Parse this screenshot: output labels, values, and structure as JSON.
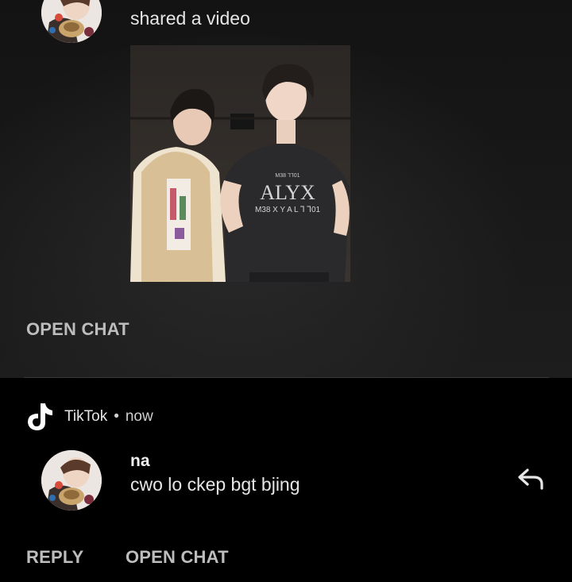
{
  "notification_1": {
    "shared_text": "shared a video",
    "thumbnail": {
      "shirt_line_1": "M38 ⅂⅂01",
      "shirt_brand": "ALYX",
      "shirt_line_2": "M38 X Y A L ⅂ ⅂01"
    },
    "open_chat_label": "OPEN CHAT"
  },
  "notification_2": {
    "app_name": "TikTok",
    "separator": "•",
    "time": "now",
    "sender": "na",
    "message": "cwo lo ckep bgt bjing",
    "reply_label": "REPLY",
    "open_chat_label": "OPEN CHAT"
  },
  "icons": {
    "app_icon": "tiktok-icon",
    "reply_icon": "reply-arrow-icon"
  },
  "colors": {
    "background": "#000000",
    "card_background": "#181818",
    "primary_text": "#e6e6e6",
    "action_text": "#bdbdbd"
  }
}
